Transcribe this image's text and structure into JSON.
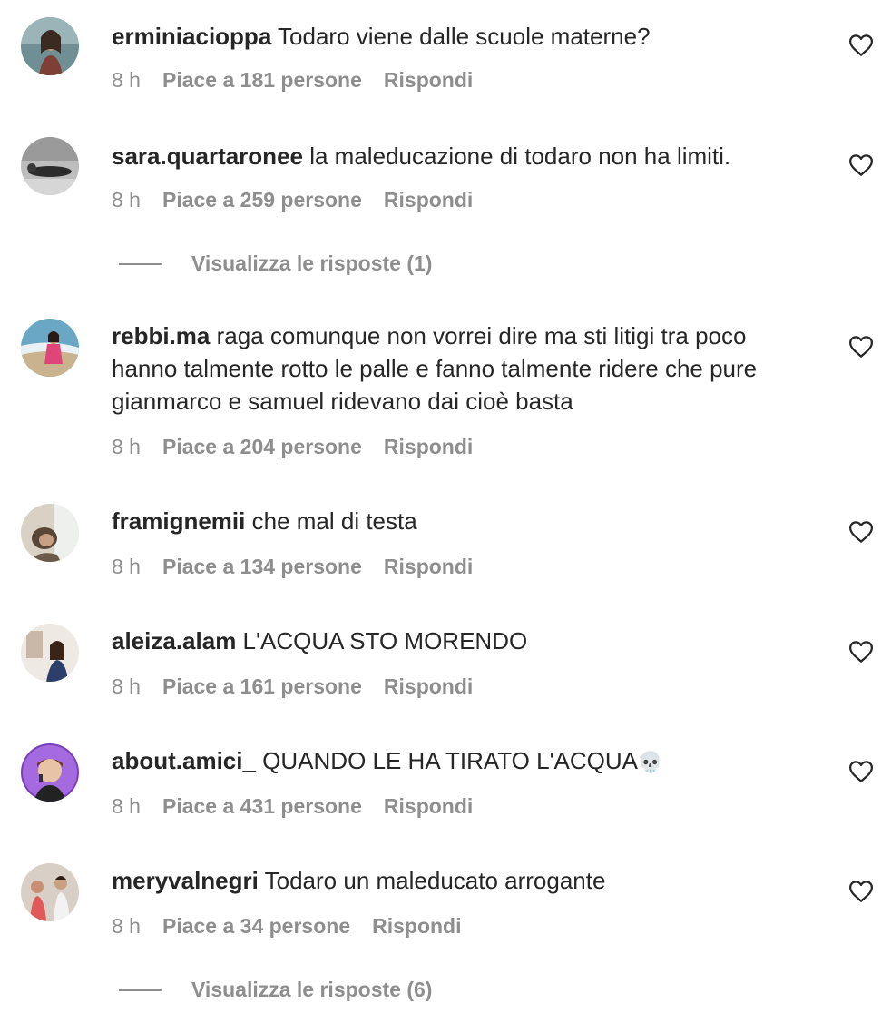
{
  "comments": [
    {
      "username": "erminiacioppa",
      "text": "Todaro viene dalle scuole materne?",
      "time": "8 h",
      "likes": "Piace a 181 persone",
      "reply": "Rispondi"
    },
    {
      "username": "sara.quartaronee",
      "text": "la maleducazione di todaro non ha limiti.",
      "time": "8 h",
      "likes": "Piace a 259 persone",
      "reply": "Rispondi",
      "view_replies": "Visualizza le risposte (1)"
    },
    {
      "username": "rebbi.ma",
      "text": "raga comunque non vorrei dire ma sti litigi tra poco hanno talmente rotto le palle e fanno talmente ridere che pure gianmarco e samuel ridevano dai cioè basta",
      "time": "8 h",
      "likes": "Piace a 204 persone",
      "reply": "Rispondi"
    },
    {
      "username": "framignemii",
      "text": "che mal di testa",
      "time": "8 h",
      "likes": "Piace a 134 persone",
      "reply": "Rispondi"
    },
    {
      "username": "aleiza.alam",
      "text": "L'ACQUA STO MORENDO",
      "time": "8 h",
      "likes": "Piace a 161 persone",
      "reply": "Rispondi"
    },
    {
      "username": "about.amici_",
      "text": "QUANDO LE HA TIRATO L'ACQUA",
      "emoji": "💀",
      "time": "8 h",
      "likes": "Piace a 431 persone",
      "reply": "Rispondi"
    },
    {
      "username": "meryvalnegri",
      "text": "Todaro un maleducato arrogante",
      "time": "8 h",
      "likes": "Piace a 34 persone",
      "reply": "Rispondi",
      "view_replies": "Visualizza le risposte (6)"
    }
  ],
  "icons": {
    "like": "heart-outline-icon",
    "avatar": "profile-photo"
  }
}
